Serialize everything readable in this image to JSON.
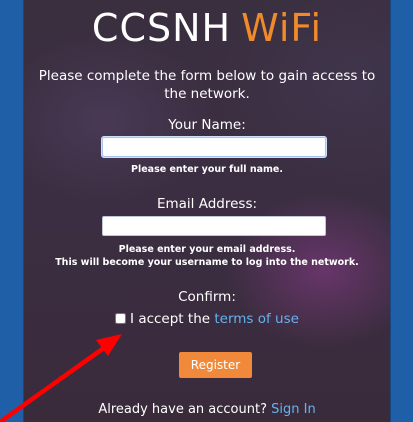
{
  "header": {
    "title_main": "CCSNH",
    "title_accent": "WiFi"
  },
  "intro_text": "Please complete the form below to gain access to the network.",
  "name_field": {
    "label": "Your Name:",
    "value": "",
    "hint": "Please enter your full name."
  },
  "email_field": {
    "label": "Email Address:",
    "value": "",
    "hint_line1": "Please enter your email address.",
    "hint_line2": "This will become your username to log into the network."
  },
  "confirm": {
    "label": "Confirm:",
    "checkbox_checked": false,
    "accept_text": "I accept the",
    "terms_link": "terms of use"
  },
  "register_button": "Register",
  "signin": {
    "prompt": "Already have an account?",
    "link": "Sign In"
  },
  "colors": {
    "background": "#1f5fa8",
    "accent": "#f08a2a",
    "link": "#66b1f0",
    "annotation_arrow": "#ff0000"
  },
  "annotation": {
    "icon": "red-arrow-icon",
    "points_to": "terms-checkbox"
  }
}
